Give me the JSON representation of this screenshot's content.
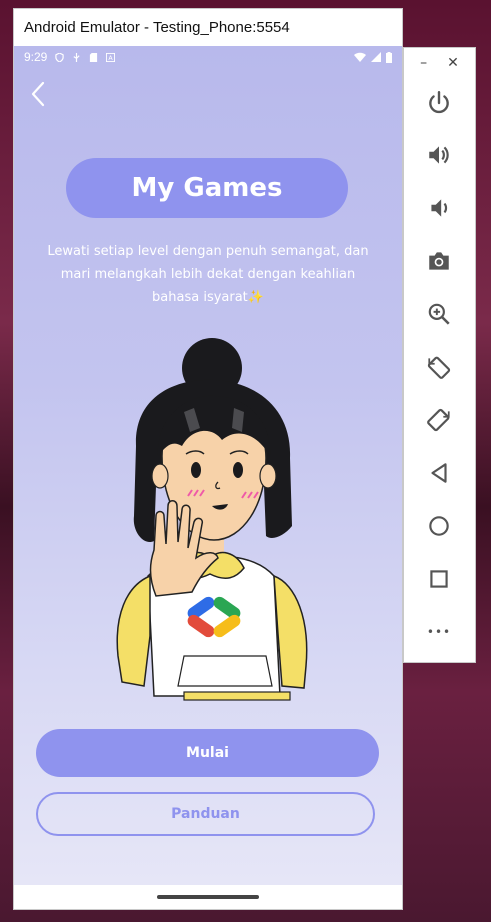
{
  "window": {
    "title": "Android Emulator - Testing_Phone:5554"
  },
  "statusbar": {
    "time": "9:29"
  },
  "screen": {
    "title": "My Games",
    "description": "Lewati setiap level dengan penuh semangat, dan mari melangkah lebih dekat dengan keahlian bahasa isyarat✨",
    "start_label": "Mulai",
    "guide_label": "Panduan"
  },
  "toolbar": {
    "minimize": "–",
    "close": "✕",
    "more": "•••"
  },
  "colors": {
    "accent": "#8f93ee",
    "phone_bg_top": "#b8b9ec",
    "phone_bg_bottom": "#e6e6f7",
    "toolbar_icon": "#555555"
  },
  "icons": {
    "back": "chevron-left-icon",
    "power": "power-icon",
    "volume_up": "volume-up-icon",
    "volume_down": "volume-down-icon",
    "camera": "camera-icon",
    "zoom": "zoom-in-icon",
    "rotate_left": "rotate-left-icon",
    "rotate_right": "rotate-right-icon",
    "nav_back": "triangle-back-icon",
    "nav_home": "circle-home-icon",
    "nav_overview": "square-overview-icon"
  }
}
